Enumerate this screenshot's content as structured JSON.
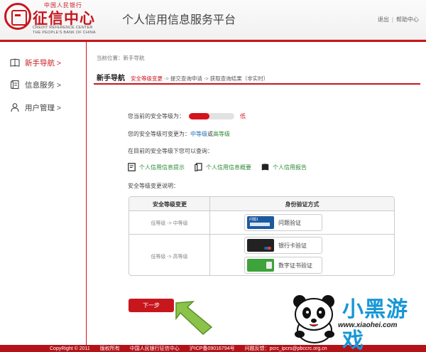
{
  "header": {
    "logo_top": "中国人民银行",
    "logo_name": "征信中心",
    "logo_en_line1": "CREDIT REFERENCE CENTER",
    "logo_en_line2": "THE PEOPLE'S BANK OF CHINA",
    "platform_title": "个人信用信息服务平台",
    "logout_label": "退出",
    "help_label": "帮助中心"
  },
  "sidebar": {
    "items": [
      {
        "label": "新手导航 >",
        "active": true,
        "icon": "book-icon"
      },
      {
        "label": "信息服务 >",
        "active": false,
        "icon": "document-icon"
      },
      {
        "label": "用户管理 >",
        "active": false,
        "icon": "user-icon"
      }
    ]
  },
  "breadcrumb": "当前位置：新手导航",
  "steps": {
    "title": "新手导航",
    "step1": "安全等级变更",
    "arrow": "->",
    "step2": "提交查询申请",
    "step3": "获取查询结果（非实时）"
  },
  "security": {
    "current_label": "您当前的安全等级为：",
    "current_level": "低",
    "level_fraction": 0.45,
    "change_prefix": "您的安全等级可变更为：",
    "change_mid": "中等级",
    "change_or": "或",
    "change_high": "高等级",
    "query_label": "在目前的安全等级下您可以查询：",
    "explain_label": "安全等级变更说明："
  },
  "query_links": [
    {
      "label": "个人信用信息提示",
      "icon": "document-icon"
    },
    {
      "label": "个人信用信息概要",
      "icon": "documents-icon"
    },
    {
      "label": "个人信用报告",
      "icon": "book-icon"
    }
  ],
  "verify_table": {
    "col1_header": "安全等级变更",
    "col2_header": "身份验证方式",
    "row1_level": "低等级 -> 中等级",
    "row2_level": "低等级 -> 高等级",
    "row1_method": "问题验证",
    "row1_thumb_text": "问题1",
    "row2_method1": "银行卡验证",
    "row2_method2": "数字证书验证"
  },
  "next_button": "下一步",
  "footer": {
    "copyright": "CopyRight © 2011",
    "rights": "版权所有",
    "org": "中国人民银行征信中心",
    "icp": "沪ICP备09016794号",
    "contact": "问题反馈：pcrc_ipcrs@pbccrc.org.cn"
  },
  "watermark": {
    "text": "小黑游戏",
    "url": "www.xiaohei.com"
  },
  "colors": {
    "brand_red": "#c8161d",
    "level_low": "#d6121b",
    "level_mid": "#1b6fb8",
    "level_high": "#2d8a3a",
    "link_green": "#2d8a3a"
  }
}
